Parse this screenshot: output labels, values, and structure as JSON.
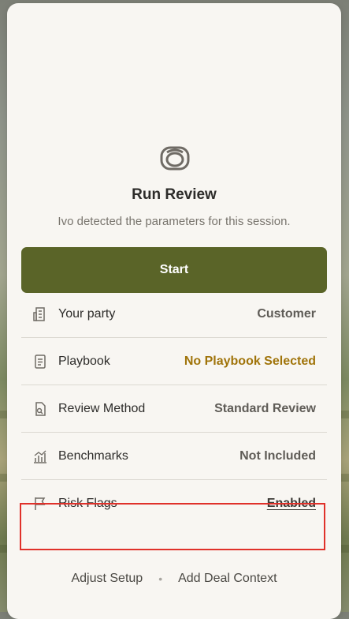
{
  "header": {
    "icon": "camera-lens-icon",
    "title": "Run Review",
    "subtitle": "Ivo detected the parameters for this session."
  },
  "start_button": {
    "label": "Start",
    "color": "#5a6428"
  },
  "parameters": [
    {
      "icon": "building-icon",
      "label": "Your party",
      "value": "Customer"
    },
    {
      "icon": "document-icon",
      "label": "Playbook",
      "value": "No Playbook Selected",
      "value_color": "#a0740a"
    },
    {
      "icon": "search-document-icon",
      "label": "Review Method",
      "value": "Standard Review"
    },
    {
      "icon": "chart-icon",
      "label": "Benchmarks",
      "value": "Not Included"
    },
    {
      "icon": "flag-icon",
      "label": "Risk Flags",
      "value": "Enabled",
      "highlighted": true
    }
  ],
  "footer": {
    "adjust_label": "Adjust Setup",
    "separator": "•",
    "context_label": "Add Deal Context"
  },
  "highlight_color": "#e0312a"
}
